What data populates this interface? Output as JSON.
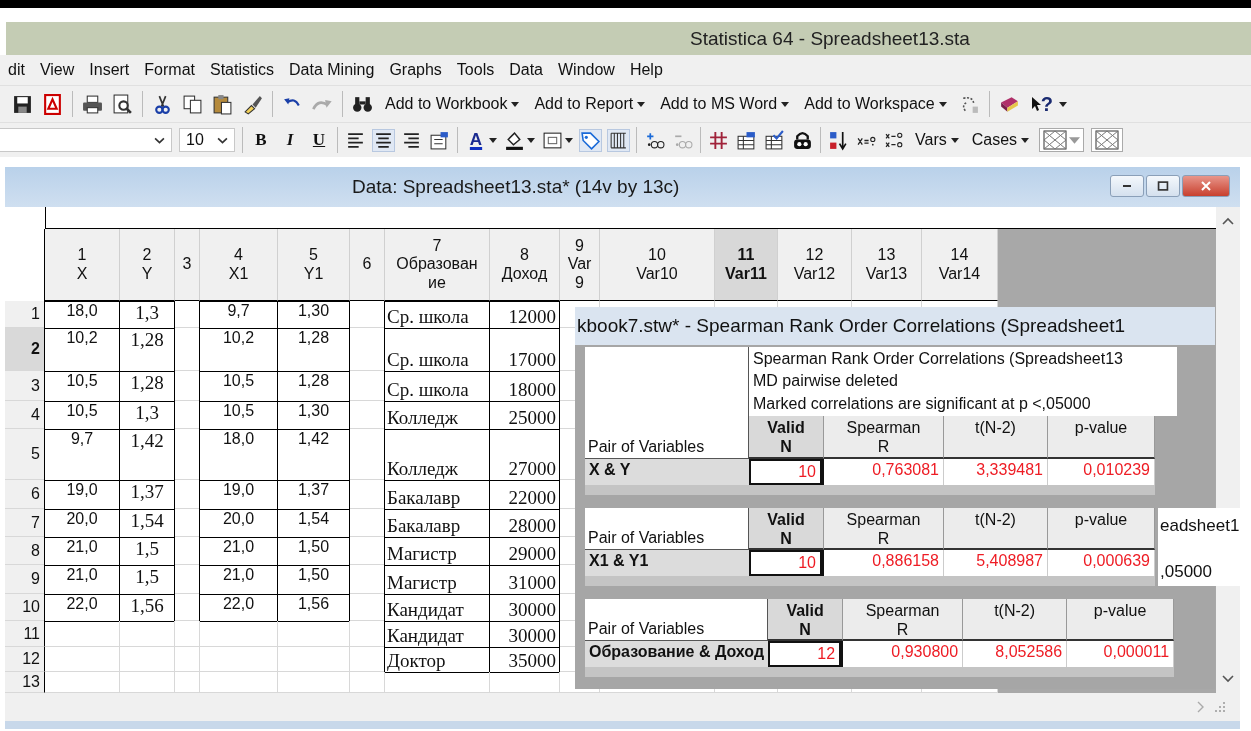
{
  "app_title": "Statistica 64 - Spreadsheet13.sta",
  "menu": [
    "dit",
    "View",
    "Insert",
    "Format",
    "Statistics",
    "Data Mining",
    "Graphs",
    "Tools",
    "Data",
    "Window",
    "Help"
  ],
  "toolbar": {
    "buttons": [
      "Add to Workbook",
      "Add to Report",
      "Add to MS Word",
      "Add to Workspace"
    ],
    "help": "?"
  },
  "format_bar": {
    "font_size": "10",
    "bold": "B",
    "italic": "I",
    "underline": "U",
    "font_color": "A",
    "buttons": [
      "Vars",
      "Cases"
    ]
  },
  "spreadsheet": {
    "title": "Data: Spreadsheet13.sta* (14v by 13c)",
    "columns": [
      {
        "number": "1",
        "name": "X",
        "selected": false
      },
      {
        "number": "2",
        "name": "Y",
        "selected": false
      },
      {
        "number": "3",
        "selected": false
      },
      {
        "number": "4",
        "name": "X1",
        "selected": false
      },
      {
        "number": "5",
        "name": "Y1",
        "selected": false
      },
      {
        "number": "6",
        "selected": false
      },
      {
        "number": "7",
        "name": "Образование",
        "selected": false
      },
      {
        "number": "8",
        "name": "Доход",
        "selected": false
      },
      {
        "number": "9",
        "name": "Var9",
        "selected": false
      },
      {
        "number": "10",
        "name": "Var10",
        "selected": false
      },
      {
        "number": "11",
        "name": "Var11",
        "selected": true
      },
      {
        "number": "12",
        "name": "Var12",
        "selected": false
      },
      {
        "number": "13",
        "name": "Var13",
        "selected": false
      },
      {
        "number": "14",
        "name": "Var14",
        "selected": false
      }
    ],
    "rows": [
      {
        "number": "1",
        "selected": false,
        "cells": [
          "18,0",
          "1,3",
          null,
          "9,7",
          "1,30",
          null,
          "Ср. школа",
          "12000"
        ]
      },
      {
        "number": "2",
        "selected": true,
        "cells": [
          "10,2",
          "1,28",
          null,
          "10,2",
          "1,28",
          null,
          "Ср. школа",
          "17000"
        ]
      },
      {
        "number": "3",
        "selected": false,
        "cells": [
          "10,5",
          "1,28",
          null,
          "10,5",
          "1,28",
          null,
          "Ср. школа",
          "18000"
        ]
      },
      {
        "number": "4",
        "selected": false,
        "cells": [
          "10,5",
          "1,3",
          null,
          "10,5",
          "1,30",
          null,
          "Колледж",
          "25000"
        ]
      },
      {
        "number": "5",
        "selected": false,
        "cells": [
          "9,7",
          "1,42",
          null,
          "18,0",
          "1,42",
          null,
          "Колледж",
          "27000"
        ]
      },
      {
        "number": "6",
        "selected": false,
        "cells": [
          "19,0",
          "1,37",
          null,
          "19,0",
          "1,37",
          null,
          "Бакалавр",
          "22000"
        ]
      },
      {
        "number": "7",
        "selected": false,
        "cells": [
          "20,0",
          "1,54",
          null,
          "20,0",
          "1,54",
          null,
          "Бакалавр",
          "28000"
        ]
      },
      {
        "number": "8",
        "selected": false,
        "cells": [
          "21,0",
          "1,5",
          null,
          "21,0",
          "1,50",
          null,
          "Магистр",
          "29000"
        ]
      },
      {
        "number": "9",
        "selected": false,
        "cells": [
          "21,0",
          "1,5",
          null,
          "21,0",
          "1,50",
          null,
          "Магистр",
          "31000"
        ]
      },
      {
        "number": "10",
        "selected": false,
        "cells": [
          "22,0",
          "1,56",
          null,
          "22,0",
          "1,56",
          null,
          "Кандидат",
          "30000"
        ]
      },
      {
        "number": "11",
        "selected": false,
        "cells": [
          null,
          null,
          null,
          null,
          null,
          null,
          "Кандидат",
          "30000"
        ]
      },
      {
        "number": "12",
        "selected": false,
        "cells": [
          null,
          null,
          null,
          null,
          null,
          null,
          "Доктор",
          "35000"
        ]
      },
      {
        "number": "13",
        "selected": false,
        "cells": []
      }
    ]
  },
  "workbook": {
    "title": "kbook7.stw* - Spearman Rank Order Correlations (Spreadsheet1",
    "tables": [
      {
        "header_lines": [
          "Spearman Rank Order Correlations (Spreadsheet13",
          "MD pairwise deleted",
          "Marked correlations are significant at p <,05000"
        ],
        "row_header": "Pair of Variables",
        "columns": [
          [
            "Valid",
            "N"
          ],
          [
            "Spearman",
            "R"
          ],
          [
            "t(N-2)"
          ],
          [
            "p-value"
          ]
        ],
        "rows": [
          {
            "pair": "X & Y",
            "significant": true,
            "values": [
              {
                "text": "10",
                "selected": true
              },
              {
                "text": "0,763081",
                "selected": false
              },
              {
                "text": "3,339481",
                "selected": false
              },
              {
                "text": "0,010239",
                "selected": false
              }
            ]
          }
        ]
      },
      {
        "row_header": "Pair of Variables",
        "columns": [
          [
            "Valid",
            "N"
          ],
          [
            "Spearman",
            "R"
          ],
          [
            "t(N-2)"
          ],
          [
            "p-value"
          ]
        ],
        "rows": [
          {
            "pair": "X1 & Y1",
            "significant": true,
            "values": [
              {
                "text": "10",
                "selected": true
              },
              {
                "text": "0,886158",
                "selected": false
              },
              {
                "text": "5,408987",
                "selected": false
              },
              {
                "text": "0,000639",
                "selected": false
              }
            ]
          }
        ]
      },
      {
        "row_header": "Pair of Variables",
        "columns": [
          [
            "Valid",
            "N"
          ],
          [
            "Spearman",
            "R"
          ],
          [
            "t(N-2)"
          ],
          [
            "p-value"
          ]
        ],
        "rows": [
          {
            "pair": "Образование & Доход",
            "significant": true,
            "values": [
              {
                "text": "12",
                "selected": true
              },
              {
                "text": "0,930800",
                "selected": false
              },
              {
                "text": "8,052586",
                "selected": false
              },
              {
                "text": "0,000011",
                "selected": false
              }
            ]
          }
        ]
      }
    ]
  },
  "background_window": {
    "lines": [
      "eadsheet1",
      ",05000"
    ]
  }
}
